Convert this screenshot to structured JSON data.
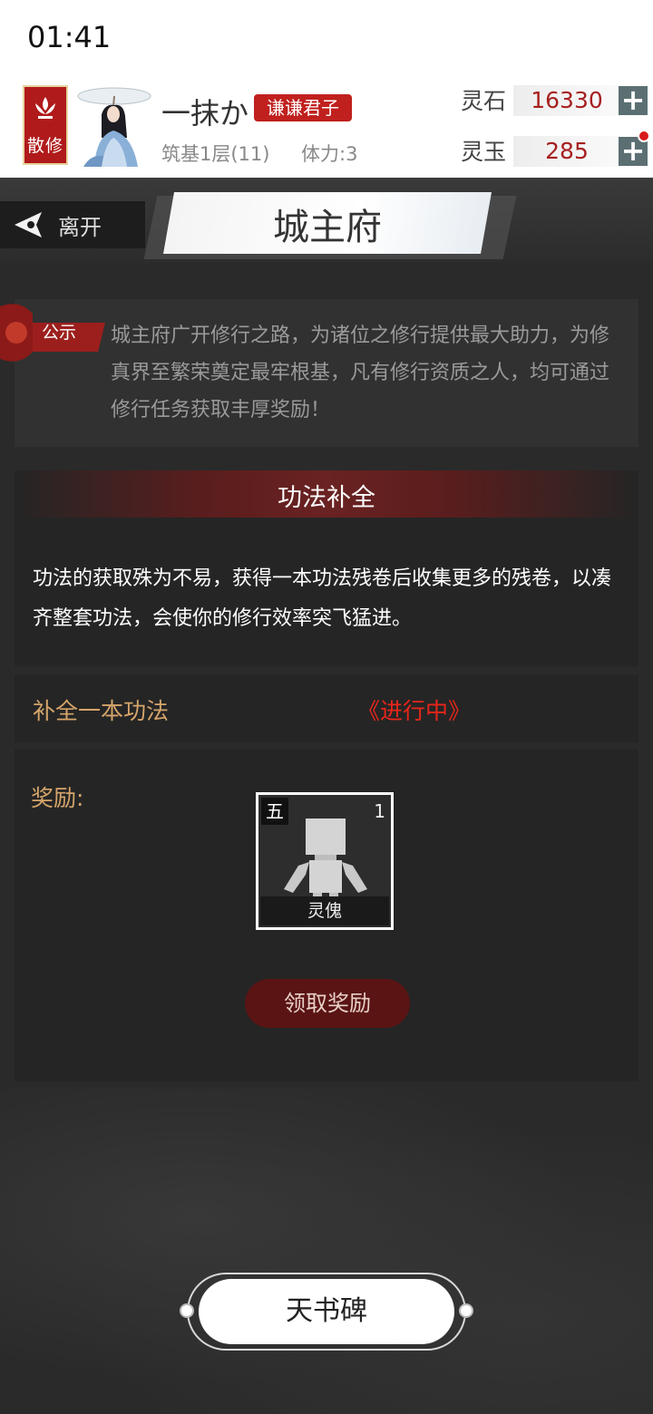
{
  "status_bar": {
    "time": "01:41"
  },
  "player": {
    "sect": "散修",
    "name": "一抹か",
    "title": "谦谦君子",
    "realm": "筑基1层(11)",
    "stamina": "体力:3"
  },
  "currencies": [
    {
      "label": "灵石",
      "value": "16330"
    },
    {
      "label": "灵玉",
      "value": "285"
    }
  ],
  "nav": {
    "leave_label": "离开",
    "page_title": "城主府"
  },
  "notice": {
    "tag": "公示",
    "text": "城主府广开修行之路，为诸位之修行提供最大助力，为修真界至繁荣奠定最牢根基，凡有修行资质之人，均可通过修行任务获取丰厚奖励！"
  },
  "task": {
    "title": "功法补全",
    "description": "功法的获取殊为不易，获得一本功法残卷后收集更多的残卷，以凑齐整套功法，会使你的修行效率突飞猛进。",
    "goal": "补全一本功法",
    "status": "《进行中》"
  },
  "reward": {
    "label": "奖励:",
    "item": {
      "grade": "五",
      "count": "1",
      "name": "灵傀"
    },
    "claim_label": "领取奖励"
  },
  "bottom": {
    "stele_label": "天书碑"
  },
  "colors": {
    "accent_red": "#c0201e",
    "status_red": "#e8261b",
    "gold_text": "#d6a56a",
    "panel": "#252525"
  }
}
